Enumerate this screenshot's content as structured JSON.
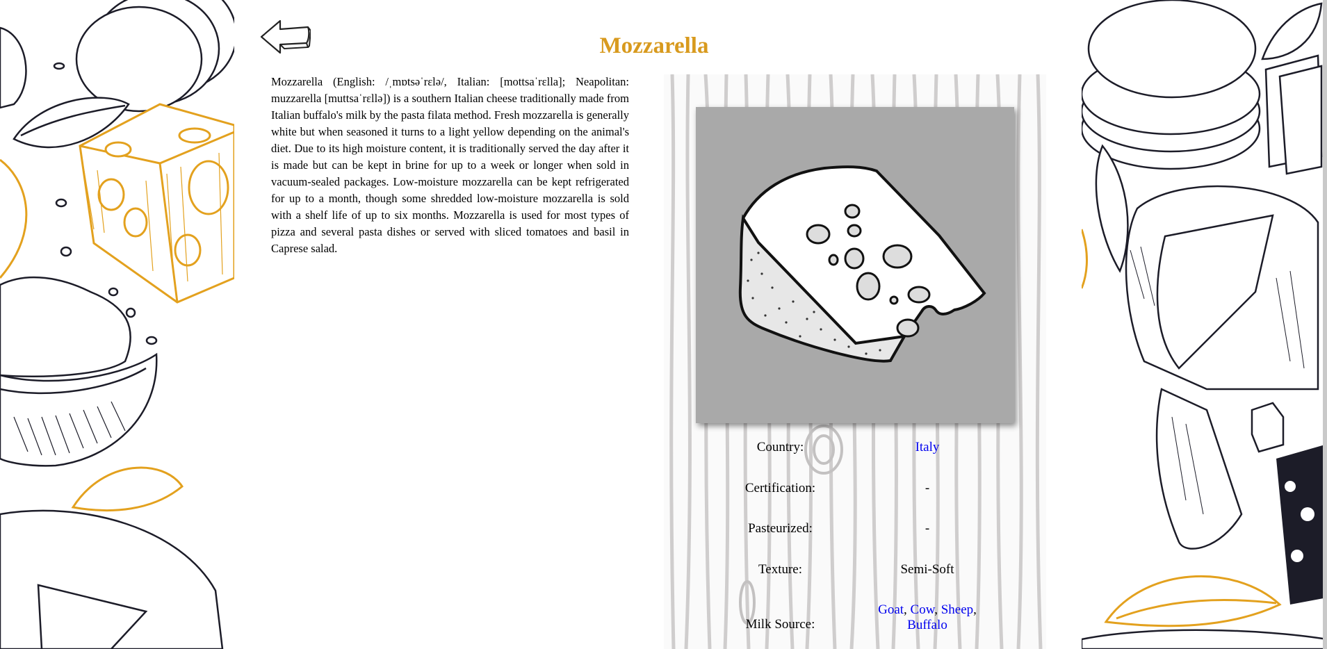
{
  "page": {
    "title": "Mozzarella",
    "title_color": "#d89a1e",
    "description": "Mozzarella (English: /ˌmɒtsəˈrɛlə/, Italian: [mottsaˈrɛlla]; Neapolitan: muzzarella [muttsaˈrɛllə]) is a southern Italian cheese traditionally made from Italian buffalo's milk by the pasta filata method. Fresh mozzarella is generally white but when seasoned it turns to a light yellow depending on the animal's diet. Due to its high moisture content, it is traditionally served the day after it is made but can be kept in brine for up to a week or longer when sold in vacuum-sealed packages. Low-moisture mozzarella can be kept refrigerated for up to a month, though some shredded low-moisture mozzarella is sold with a shelf life of up to six months. Mozzarella is used for most types of pizza and several pasta dishes or served with sliced tomatoes and basil in Caprese salad."
  },
  "navigation": {
    "back_icon": "left-arrow-icon"
  },
  "image": {
    "icon": "cheese-wedge-illustration",
    "background": "#a9a9a9"
  },
  "attributes": {
    "country_label": "Country:",
    "country_value": "Italy",
    "certification_label": "Certification:",
    "certification_value": "-",
    "pasteurized_label": "Pasteurized:",
    "pasteurized_value": "-",
    "texture_label": "Texture:",
    "texture_value": "Semi-Soft",
    "milk_label": "Milk Source:",
    "milk_sources": [
      "Goat",
      "Cow",
      "Sheep",
      "Buffalo"
    ],
    "link_color": "#0000ee"
  },
  "theme": {
    "accent": "#e3a11e",
    "ink": "#1c1c28"
  }
}
